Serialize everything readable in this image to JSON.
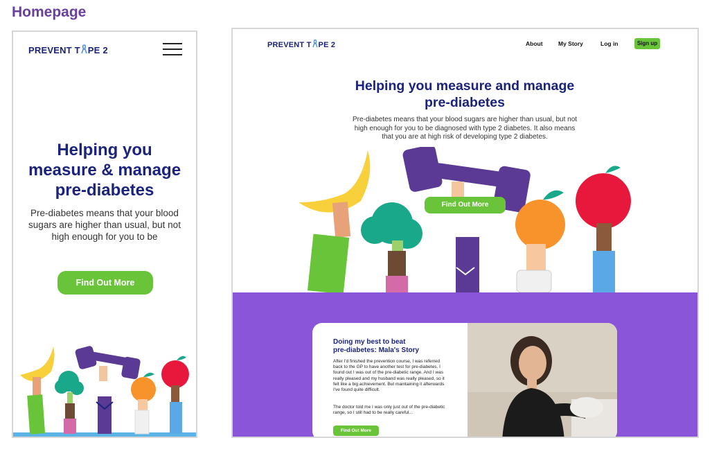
{
  "page_heading": "Homepage",
  "brand": {
    "logo_before": "PREVENT T",
    "logo_after": "PE 2"
  },
  "mobile": {
    "title_lines": [
      "Helping you",
      "measure & manage",
      "pre-diabetes"
    ],
    "intro": "Pre-diabetes means that your blood sugars are higher than usual, but not high enough for you to be",
    "cta": "Find Out More"
  },
  "desktop": {
    "nav": {
      "about": "About",
      "my_story": "My Story",
      "log_in": "Log in",
      "sign_up": "Sign up"
    },
    "title_lines": [
      "Helping you measure and manage",
      "pre-diabetes"
    ],
    "intro": "Pre-diabetes means that your blood sugars are higher than usual, but not high enough for you to be diagnosed with type 2 diabetes. It also means that you are at high risk of developing type 2 diabetes.",
    "cta": "Find Out More",
    "story": {
      "title_lines": [
        "Doing my best to beat",
        "pre-diabetes: Mala's Story"
      ],
      "paragraph1": "After I'd finished the prevention course, I was referred back to the GP to have another test for pre-diabetes. I found out I was out of the pre-diabetic range. And I was really pleased and my husband was really pleased, so it felt like a big achievement. But maintaining it afterwards I've found quite difficult.",
      "paragraph2": "The doctor told me I was only just out of the pre-diabetic range, so I still had to be really careful…",
      "cta": "Find Out More"
    }
  },
  "colors": {
    "brand_navy": "#1a237e",
    "cta_green": "#6ac43a",
    "story_purple": "#8a55d8",
    "heading_purple": "#6b3fa0"
  },
  "icons": [
    "awareness-ribbon-icon",
    "hamburger-menu-icon",
    "chevron-down-icon"
  ]
}
